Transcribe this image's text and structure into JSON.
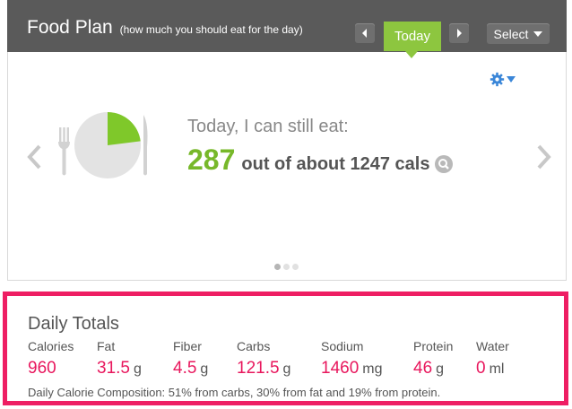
{
  "header": {
    "title": "Food Plan",
    "subtitle": "(how much you should eat for the day)",
    "prev_icon": "chevron-left-icon",
    "next_icon": "chevron-right-icon",
    "today_label": "Today",
    "select_label": "Select"
  },
  "summary": {
    "headline": "Today, I can still eat:",
    "calories_remaining": "287",
    "calories_text": "out of about 1247 cals",
    "plate_eaten_fraction": 0.23,
    "carousel_pages": 3,
    "carousel_active": 0
  },
  "daily_totals": {
    "title": "Daily Totals",
    "columns": [
      {
        "label": "Calories",
        "value": "960",
        "unit": ""
      },
      {
        "label": "Fat",
        "value": "31.5",
        "unit": "g"
      },
      {
        "label": "Fiber",
        "value": "4.5",
        "unit": "g"
      },
      {
        "label": "Carbs",
        "value": "121.5",
        "unit": "g"
      },
      {
        "label": "Sodium",
        "value": "1460",
        "unit": "mg"
      },
      {
        "label": "Protein",
        "value": "46",
        "unit": "g"
      },
      {
        "label": "Water",
        "value": "0",
        "unit": "ml"
      }
    ],
    "composition": "Daily Calorie Composition: 51% from carbs, 30% from fat and 19% from protein."
  },
  "colors": {
    "header_bg": "#5a5a5a",
    "accent_green": "#8dc63f",
    "highlight_pink": "#ee1e63",
    "value_pink": "#e8175d",
    "gear_blue": "#3a86d8"
  }
}
